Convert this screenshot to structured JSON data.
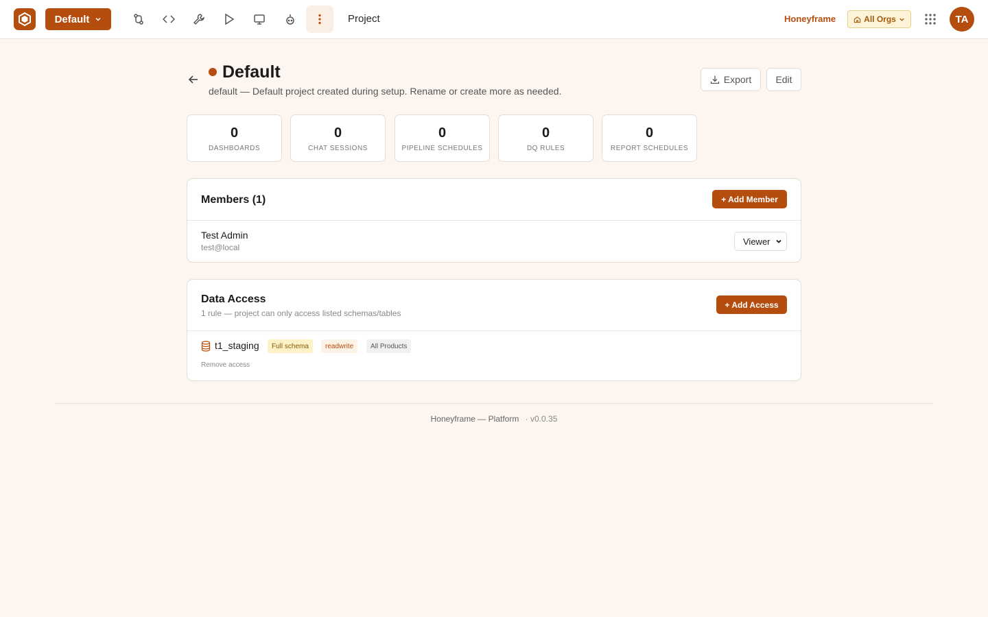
{
  "topbar": {
    "project_label": "Default",
    "nav_title": "Project",
    "org_name": "Honeyframe",
    "org_filter_label": "All Orgs",
    "avatar_initials": "TA",
    "brand_color": "#b54d0f"
  },
  "header": {
    "title": "Default",
    "description": "default — Default project created during setup. Rename or create more as needed.",
    "export_label": "Export",
    "edit_label": "Edit"
  },
  "stats": [
    {
      "value": "0",
      "label": "DASHBOARDS"
    },
    {
      "value": "0",
      "label": "CHAT SESSIONS"
    },
    {
      "value": "0",
      "label": "PIPELINE SCHEDULES"
    },
    {
      "value": "0",
      "label": "DQ RULES"
    },
    {
      "value": "0",
      "label": "REPORT SCHEDULES"
    }
  ],
  "members": {
    "title": "Members (1)",
    "add_label": "+ Add Member",
    "items": [
      {
        "name": "Test Admin",
        "email": "test@local",
        "role": "Viewer"
      }
    ]
  },
  "data_access": {
    "title": "Data Access",
    "subtitle": "1 rule — project can only access listed schemas/tables",
    "add_label": "+ Add Access",
    "rules": [
      {
        "schema": "t1_staging",
        "scope": "Full schema",
        "mode": "readwrite",
        "products": "All Products",
        "remove_label": "Remove access"
      }
    ]
  },
  "footer": {
    "text": "Honeyframe — Platform",
    "version": "· v0.0.35"
  }
}
